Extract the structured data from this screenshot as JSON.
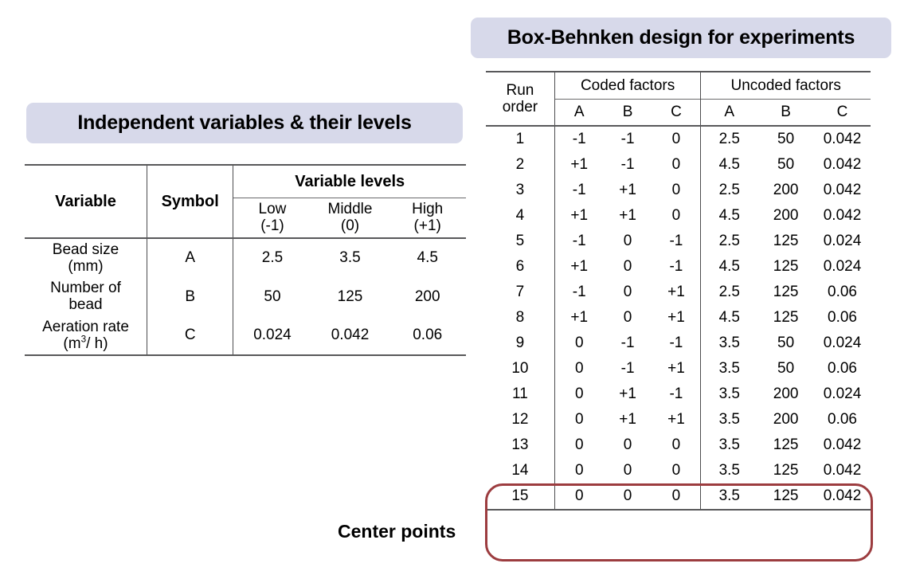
{
  "banners": {
    "left_title": "Independent variables & their levels",
    "right_title": "Box-Behnken design for experiments",
    "background_color": "#d7d9ea"
  },
  "independent_variables_table": {
    "headers": {
      "variable": "Variable",
      "symbol": "Symbol",
      "variable_levels": "Variable levels",
      "low_name": "Low",
      "low_code": "(-1)",
      "middle_name": "Middle",
      "middle_code": "(0)",
      "high_name": "High",
      "high_code": "(+1)"
    },
    "rows": [
      {
        "variable_line1": "Bead size",
        "variable_line2": "(mm)",
        "symbol": "A",
        "low": "2.5",
        "middle": "3.5",
        "high": "4.5"
      },
      {
        "variable_line1": "Number of",
        "variable_line2": "bead",
        "symbol": "B",
        "low": "50",
        "middle": "125",
        "high": "200"
      },
      {
        "variable_line1": "Aeration rate",
        "variable_line2_pre": "(m",
        "variable_line2_sup": "3",
        "variable_line2_post": "/ h)",
        "symbol": "C",
        "low": "0.024",
        "middle": "0.042",
        "high": "0.06"
      }
    ]
  },
  "box_behnken_table": {
    "headers": {
      "run_line1": "Run",
      "run_line2": "order",
      "coded_group": "Coded factors",
      "uncoded_group": "Uncoded factors",
      "coded_a": "A",
      "coded_b": "B",
      "coded_c": "C",
      "uncoded_a": "A",
      "uncoded_b": "B",
      "uncoded_c": "C"
    },
    "rows": [
      {
        "run": "1",
        "cA": "-1",
        "cB": "-1",
        "cC": "0",
        "uA": "2.5",
        "uB": "50",
        "uC": "0.042"
      },
      {
        "run": "2",
        "cA": "+1",
        "cB": "-1",
        "cC": "0",
        "uA": "4.5",
        "uB": "50",
        "uC": "0.042"
      },
      {
        "run": "3",
        "cA": "-1",
        "cB": "+1",
        "cC": "0",
        "uA": "2.5",
        "uB": "200",
        "uC": "0.042"
      },
      {
        "run": "4",
        "cA": "+1",
        "cB": "+1",
        "cC": "0",
        "uA": "4.5",
        "uB": "200",
        "uC": "0.042"
      },
      {
        "run": "5",
        "cA": "-1",
        "cB": "0",
        "cC": "-1",
        "uA": "2.5",
        "uB": "125",
        "uC": "0.024"
      },
      {
        "run": "6",
        "cA": "+1",
        "cB": "0",
        "cC": "-1",
        "uA": "4.5",
        "uB": "125",
        "uC": "0.024"
      },
      {
        "run": "7",
        "cA": "-1",
        "cB": "0",
        "cC": "+1",
        "uA": "2.5",
        "uB": "125",
        "uC": "0.06"
      },
      {
        "run": "8",
        "cA": "+1",
        "cB": "0",
        "cC": "+1",
        "uA": "4.5",
        "uB": "125",
        "uC": "0.06"
      },
      {
        "run": "9",
        "cA": "0",
        "cB": "-1",
        "cC": "-1",
        "uA": "3.5",
        "uB": "50",
        "uC": "0.024"
      },
      {
        "run": "10",
        "cA": "0",
        "cB": "-1",
        "cC": "+1",
        "uA": "3.5",
        "uB": "50",
        "uC": "0.06"
      },
      {
        "run": "11",
        "cA": "0",
        "cB": "+1",
        "cC": "-1",
        "uA": "3.5",
        "uB": "200",
        "uC": "0.024"
      },
      {
        "run": "12",
        "cA": "0",
        "cB": "+1",
        "cC": "+1",
        "uA": "3.5",
        "uB": "200",
        "uC": "0.06"
      },
      {
        "run": "13",
        "cA": "0",
        "cB": "0",
        "cC": "0",
        "uA": "3.5",
        "uB": "125",
        "uC": "0.042"
      },
      {
        "run": "14",
        "cA": "0",
        "cB": "0",
        "cC": "0",
        "uA": "3.5",
        "uB": "125",
        "uC": "0.042"
      },
      {
        "run": "15",
        "cA": "0",
        "cB": "0",
        "cC": "0",
        "uA": "3.5",
        "uB": "125",
        "uC": "0.042"
      }
    ]
  },
  "annotation": {
    "center_points_label": "Center points",
    "highlight_color": "#9c3c3f",
    "highlighted_runs": [
      "13",
      "14",
      "15"
    ]
  }
}
